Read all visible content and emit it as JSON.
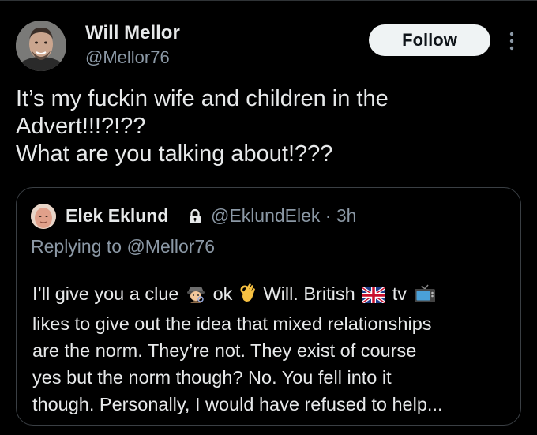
{
  "author": {
    "display_name": "Will Mellor",
    "handle": "@Mellor76",
    "avatar_icon": "profile-photo"
  },
  "follow_label": "Follow",
  "tweet": {
    "lines": [
      "It’s my fuckin wife and children in the",
      "Advert!!!?!??",
      "What are you talking about!???"
    ]
  },
  "quoted": {
    "display_name": "Elek Eklund",
    "handle_time": "@EklundElek · 3h",
    "replying_to": "Replying to @Mellor76",
    "line1_part1": "I’ll give you a clue",
    "line1_part2": "ok",
    "line1_part3": "Will. British",
    "line1_part4": "tv",
    "lines": [
      "likes to give out the idea that mixed relationships",
      "are the norm. They’re not. They exist of course",
      "yes but the norm though? No. You fell into it",
      "though. Personally, I would have refused to help..."
    ],
    "emoji_icons": [
      "detective-emoji",
      "ok-hand-emoji",
      "uk-flag-emoji",
      "tv-emoji"
    ]
  },
  "colors": {
    "background": "#000000",
    "text": "#e7e9ea",
    "secondary_text": "#8b98a5",
    "follow_bg": "#eff3f4",
    "border": "#3a3f44"
  }
}
